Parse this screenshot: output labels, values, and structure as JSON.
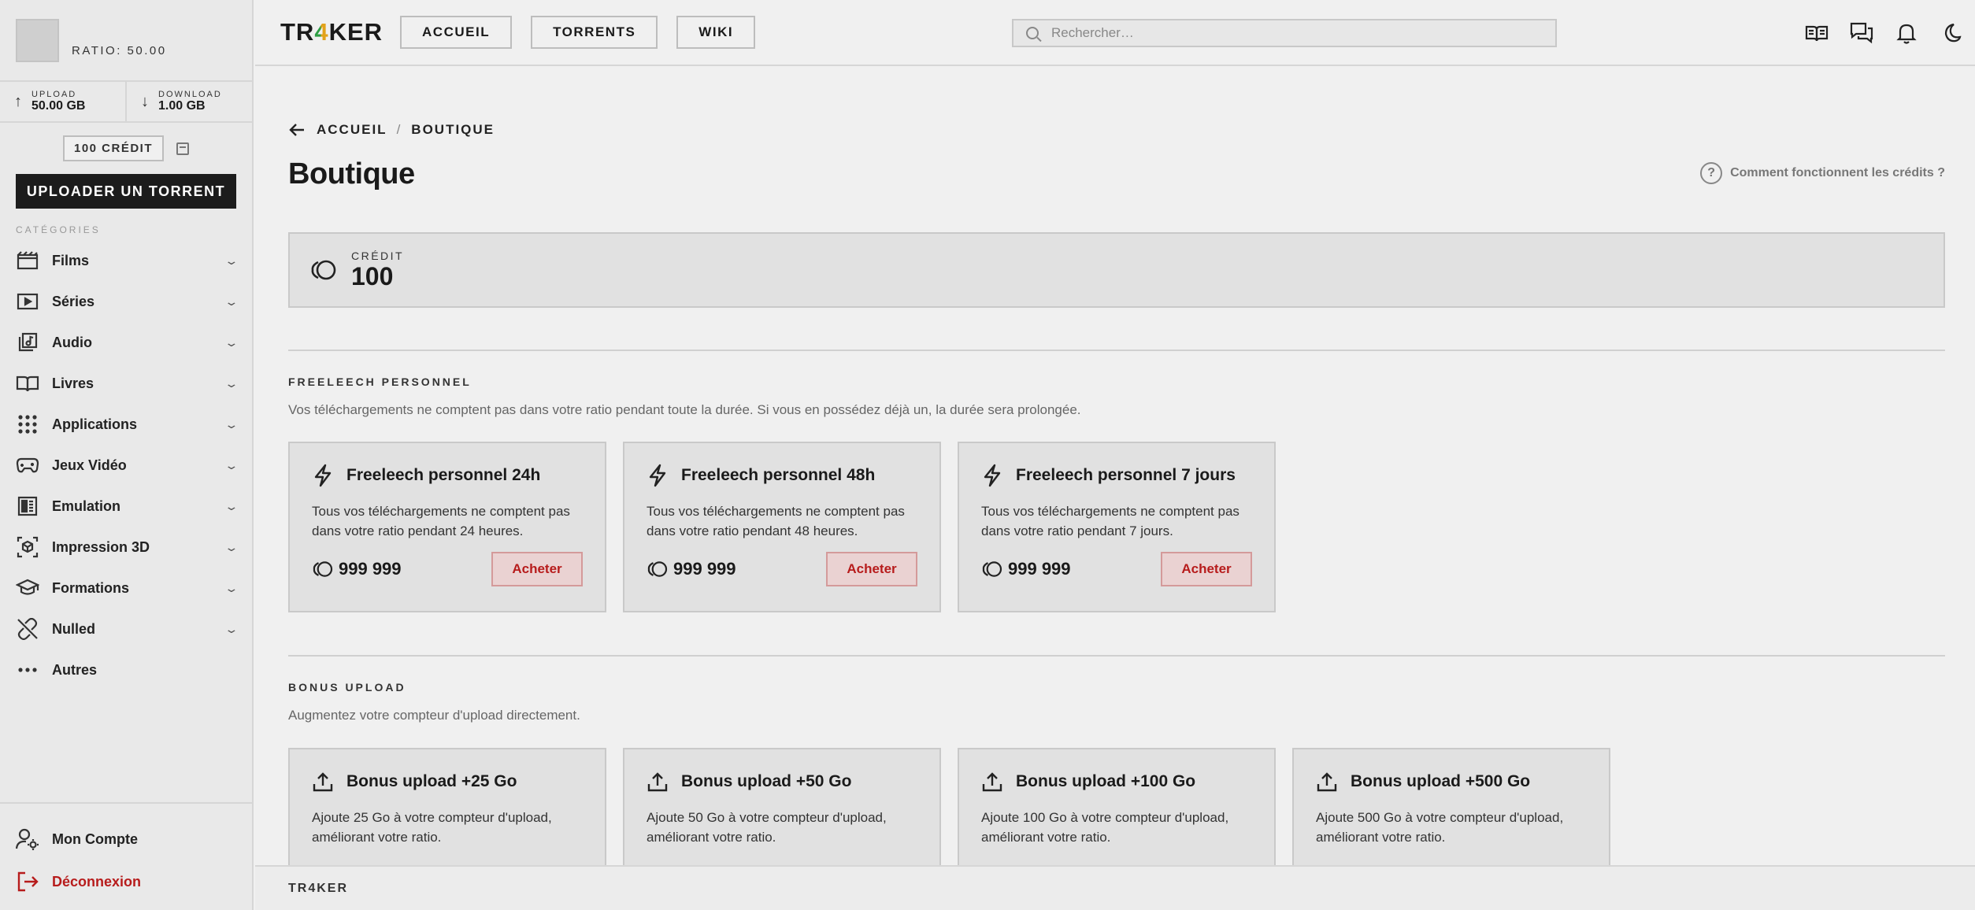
{
  "sidebar": {
    "ratio": "RATIO: 50.00",
    "upload": {
      "label": "UPLOAD",
      "value": "50.00 GB"
    },
    "download": {
      "label": "DOWNLOAD",
      "value": "1.00 GB"
    },
    "credit_label": "100 CRÉDIT",
    "upload_button": "UPLOADER UN TORRENT",
    "categories_title": "CATÉGORIES",
    "categories": [
      {
        "label": "Films",
        "icon": "film-icon"
      },
      {
        "label": "Séries",
        "icon": "tv-play-icon"
      },
      {
        "label": "Audio",
        "icon": "music-library-icon"
      },
      {
        "label": "Livres",
        "icon": "book-open-icon"
      },
      {
        "label": "Applications",
        "icon": "apps-grid-icon"
      },
      {
        "label": "Jeux Vidéo",
        "icon": "gamepad-icon"
      },
      {
        "label": "Emulation",
        "icon": "emulation-icon"
      },
      {
        "label": "Impression 3D",
        "icon": "cube-3d-icon"
      },
      {
        "label": "Formations",
        "icon": "graduation-cap-icon"
      },
      {
        "label": "Nulled",
        "icon": "broken-link-icon"
      },
      {
        "label": "Autres",
        "icon": "more-dots-icon"
      }
    ],
    "account": "Mon Compte",
    "logout": "Déconnexion"
  },
  "topbar": {
    "logo": {
      "a": "TR",
      "b": "4",
      "c": "KER"
    },
    "nav": [
      "ACCUEIL",
      "TORRENTS",
      "WIKI"
    ],
    "search_placeholder": "Rechercher…"
  },
  "main": {
    "breadcrumb": [
      "ACCUEIL",
      "BOUTIQUE"
    ],
    "title": "Boutique",
    "help": "Comment fonctionnent les crédits ?",
    "credit": {
      "label": "CRÉDIT",
      "value": "100"
    },
    "sections": [
      {
        "title": "FREELEECH PERSONNEL",
        "desc": "Vos téléchargements ne comptent pas dans votre ratio pendant toute la durée. Si vous en possédez déjà un, la durée sera prolongée.",
        "cards": [
          {
            "title": "Freeleech personnel 24h",
            "desc": "Tous vos téléchargements ne comptent pas dans votre ratio pendant 24 heures.",
            "price": "999 999",
            "button": "Acheter"
          },
          {
            "title": "Freeleech personnel 48h",
            "desc": "Tous vos téléchargements ne comptent pas dans votre ratio pendant 48 heures.",
            "price": "999 999",
            "button": "Acheter"
          },
          {
            "title": "Freeleech personnel 7 jours",
            "desc": "Tous vos téléchargements ne comptent pas dans votre ratio pendant 7 jours.",
            "price": "999 999",
            "button": "Acheter"
          }
        ]
      },
      {
        "title": "BONUS UPLOAD",
        "desc": "Augmentez votre compteur d'upload directement.",
        "cards": [
          {
            "title": "Bonus upload +25 Go",
            "desc": "Ajoute 25 Go à votre compteur d'upload, améliorant votre ratio."
          },
          {
            "title": "Bonus upload +50 Go",
            "desc": "Ajoute 50 Go à votre compteur d'upload, améliorant votre ratio."
          },
          {
            "title": "Bonus upload +100 Go",
            "desc": "Ajoute 100 Go à votre compteur d'upload, améliorant votre ratio."
          },
          {
            "title": "Bonus upload +500 Go",
            "desc": "Ajoute 500 Go à votre compteur d'upload, améliorant votre ratio."
          }
        ]
      }
    ]
  },
  "footer": "TR4KER"
}
